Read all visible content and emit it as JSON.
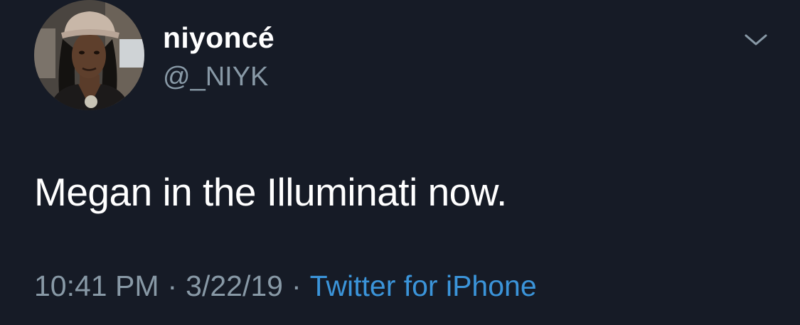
{
  "tweet": {
    "display_name": "niyoncé",
    "handle": "@_NIYK",
    "text": "Megan in the Illuminati now.",
    "time": "10:41 PM",
    "separator": "·",
    "date": "3/22/19",
    "source": "Twitter for iPhone"
  },
  "icons": {
    "menu": "chevron-down-icon",
    "avatar": "profile-photo"
  },
  "colors": {
    "background": "#161b26",
    "primary_text": "#ffffff",
    "secondary_text": "#8899a6",
    "link": "#3b94d9"
  }
}
